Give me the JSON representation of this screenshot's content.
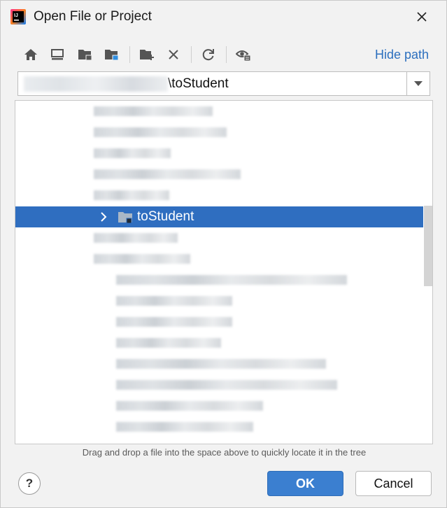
{
  "window": {
    "title": "Open File or Project"
  },
  "toolbar": {
    "icons": [
      "home-icon",
      "desktop-icon",
      "project-folder-icon",
      "module-folder-icon",
      "new-folder-icon",
      "delete-icon",
      "refresh-icon",
      "show-hidden-icon"
    ],
    "hide_path_label": "Hide path"
  },
  "path": {
    "visible_suffix": "\\toStudent"
  },
  "tree": {
    "selected_item": "toStudent",
    "hint": "Drag and drop a file into the space above to quickly locate it in the tree"
  },
  "buttons": {
    "help": "?",
    "ok": "OK",
    "cancel": "Cancel"
  },
  "colors": {
    "selection": "#2f6ec0",
    "ok_button": "#3b7fd0",
    "link": "#2c6fbe"
  }
}
